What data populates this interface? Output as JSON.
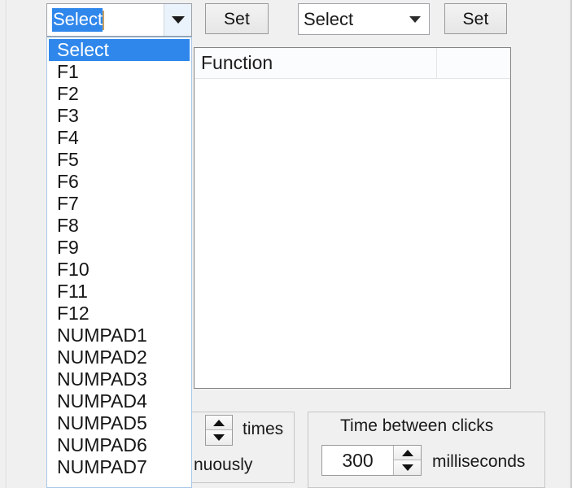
{
  "window": {
    "background_color": "#f0f0f0"
  },
  "toolbar": {
    "hotkey_combo": {
      "value": "Select",
      "selected_text": "Select",
      "arrow_icon": "chevron-down-icon"
    },
    "hotkey_set_label": "Set",
    "action_combo": {
      "value": "Select",
      "arrow_icon": "chevron-down-icon"
    },
    "action_set_label": "Set"
  },
  "dropdown": {
    "open": true,
    "highlight_color": "#2f87ec",
    "selected_index": 0,
    "items": [
      "Select",
      "F1",
      "F2",
      "F3",
      "F4",
      "F5",
      "F6",
      "F7",
      "F8",
      "F9",
      "F10",
      "F11",
      "F12",
      "NUMPAD1",
      "NUMPAD2",
      "NUMPAD3",
      "NUMPAD4",
      "NUMPAD5",
      "NUMPAD6",
      "NUMPAD7"
    ]
  },
  "grid": {
    "columns": [
      "Function",
      ""
    ],
    "rows": []
  },
  "repeat_group": {
    "times_label": "times",
    "continuously_label": "nuously",
    "spinner_icon": "spinner-up-down-icon"
  },
  "time_group": {
    "title": "Time between clicks",
    "value": "300",
    "unit_label": "milliseconds",
    "spinner_icon": "spinner-up-down-icon"
  }
}
